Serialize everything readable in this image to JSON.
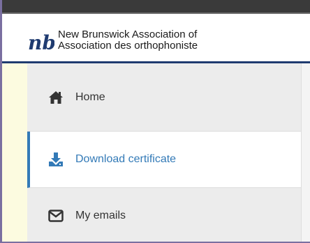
{
  "header": {
    "logo_icon": "nb-logo",
    "org_name_line1": "New Brunswick Association of",
    "org_name_line2": "Association des orthophoniste"
  },
  "menu": {
    "items": [
      {
        "label": "Home",
        "icon": "home-icon"
      },
      {
        "label": "Download certificate",
        "icon": "download-icon",
        "active": true
      },
      {
        "label": "My emails",
        "icon": "envelope-icon"
      }
    ]
  },
  "colors": {
    "accent": "#337ab7",
    "header_border": "#1f3b70",
    "logo": "#1f3b70",
    "side_strip": "#fcfbe0",
    "item_background": "#ececec"
  }
}
